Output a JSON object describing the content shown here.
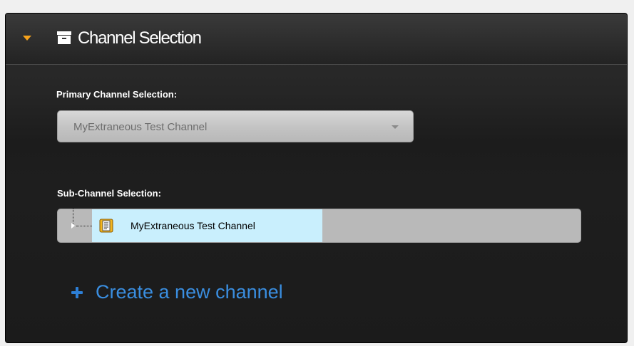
{
  "panel": {
    "title": "Channel Selection",
    "collapse_icon": "triangle-down-icon",
    "header_icon": "archive-box-icon",
    "accent_color": "#f7a21b"
  },
  "primary": {
    "label": "Primary Channel Selection:",
    "selected_value": "MyExtraneous Test Channel",
    "caret_icon": "chevron-down-icon"
  },
  "sub": {
    "label": "Sub-Channel Selection:",
    "tree_items": [
      {
        "label": "MyExtraneous Test Channel",
        "icon": "channel-document-icon",
        "selected": true
      }
    ],
    "selection_color": "#c9effd"
  },
  "actions": {
    "create_label": "Create a new channel",
    "create_icon": "plus-icon",
    "link_color": "#3a8ee0"
  }
}
